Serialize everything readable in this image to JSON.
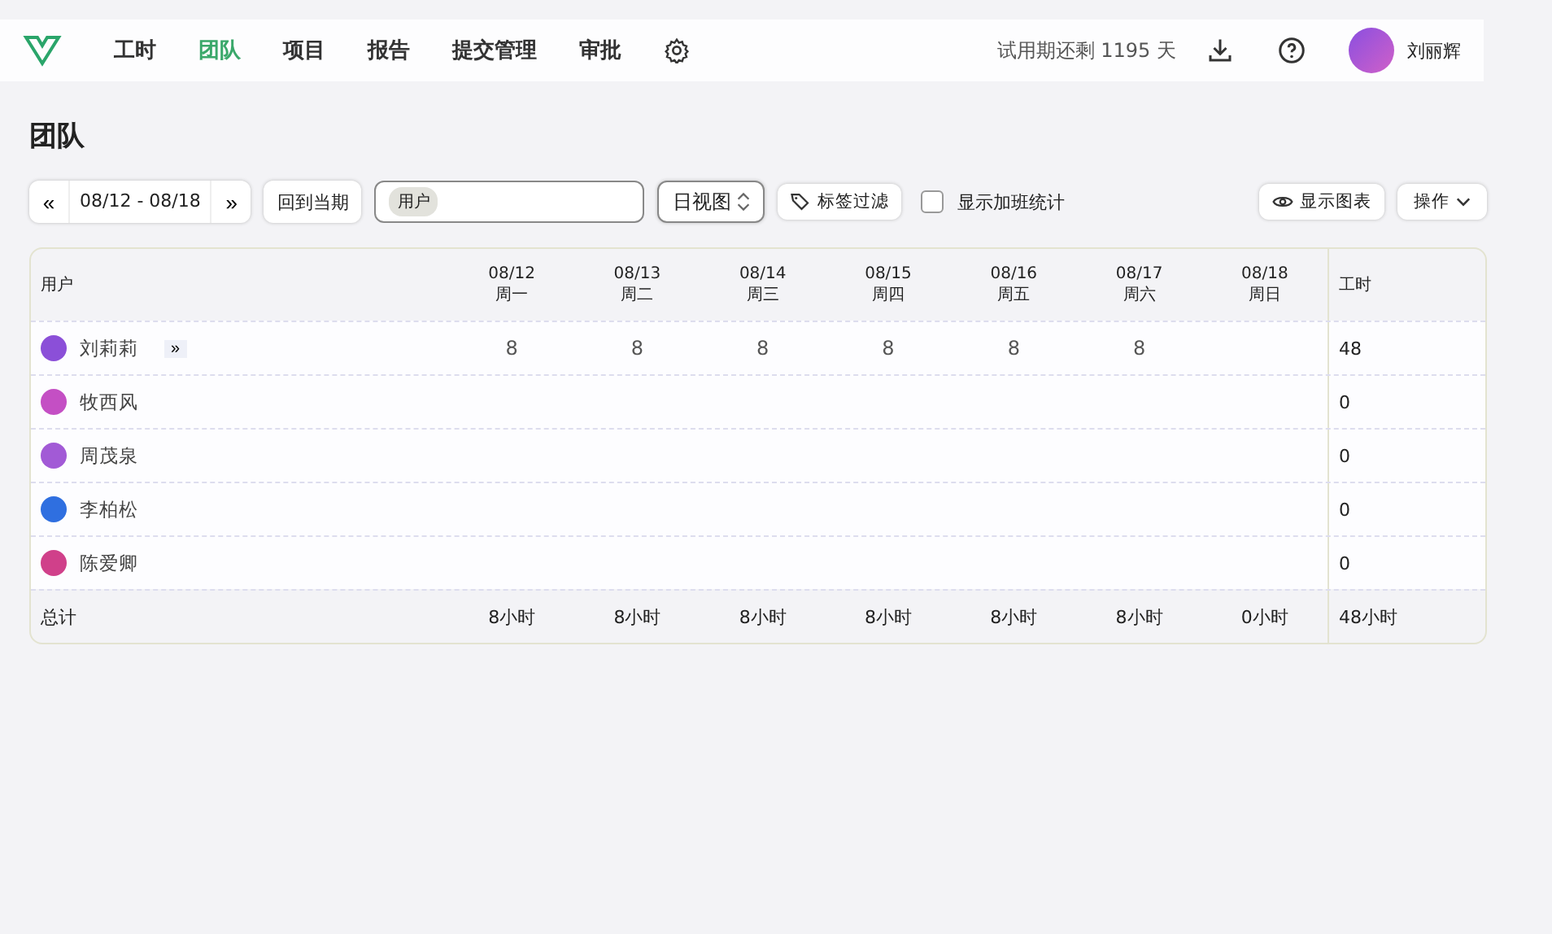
{
  "nav": {
    "items": [
      {
        "label": "工时",
        "selected": false
      },
      {
        "label": "团队",
        "selected": true
      },
      {
        "label": "项目",
        "selected": false
      },
      {
        "label": "报告",
        "selected": false
      },
      {
        "label": "提交管理",
        "selected": false
      },
      {
        "label": "审批",
        "selected": false
      }
    ],
    "trial": "试用期还剩 1195 天",
    "user": "刘丽辉"
  },
  "page_title": "团队",
  "toolbar": {
    "prev": "«",
    "range": "08/12 - 08/18",
    "next": "»",
    "current": "回到当期",
    "filter_chip": "用户",
    "view": "日视图",
    "tag_filter": "标签过滤",
    "overtime": {
      "label": "显示加班统计",
      "checked": false
    },
    "show_chart": "显示图表",
    "actions": "操作"
  },
  "table": {
    "user_header": "用户",
    "total_header": "工时",
    "days": [
      {
        "date": "08/12",
        "weekday": "周一"
      },
      {
        "date": "08/13",
        "weekday": "周二"
      },
      {
        "date": "08/14",
        "weekday": "周三"
      },
      {
        "date": "08/15",
        "weekday": "周四"
      },
      {
        "date": "08/16",
        "weekday": "周五"
      },
      {
        "date": "08/17",
        "weekday": "周六"
      },
      {
        "date": "08/18",
        "weekday": "周日"
      }
    ],
    "rows": [
      {
        "name": "刘莉莉",
        "expand": "»",
        "cells": [
          "8",
          "8",
          "8",
          "8",
          "8",
          "8",
          ""
        ],
        "total": "48",
        "color": "#8b4fd8"
      },
      {
        "name": "牧西风",
        "cells": [
          "",
          "",
          "",
          "",
          "",
          "",
          ""
        ],
        "total": "0",
        "color": "#c44fc4"
      },
      {
        "name": "周茂泉",
        "cells": [
          "",
          "",
          "",
          "",
          "",
          "",
          ""
        ],
        "total": "0",
        "color": "#a25ad6"
      },
      {
        "name": "李柏松",
        "cells": [
          "",
          "",
          "",
          "",
          "",
          "",
          ""
        ],
        "total": "0",
        "color": "#2f6fe0"
      },
      {
        "name": "陈爱卿",
        "cells": [
          "",
          "",
          "",
          "",
          "",
          "",
          ""
        ],
        "total": "0",
        "color": "#d0408a"
      }
    ],
    "footer": {
      "label": "总计",
      "cells": [
        "8小时",
        "8小时",
        "8小时",
        "8小时",
        "8小时",
        "8小时",
        "0小时"
      ],
      "total": "48小时"
    }
  }
}
